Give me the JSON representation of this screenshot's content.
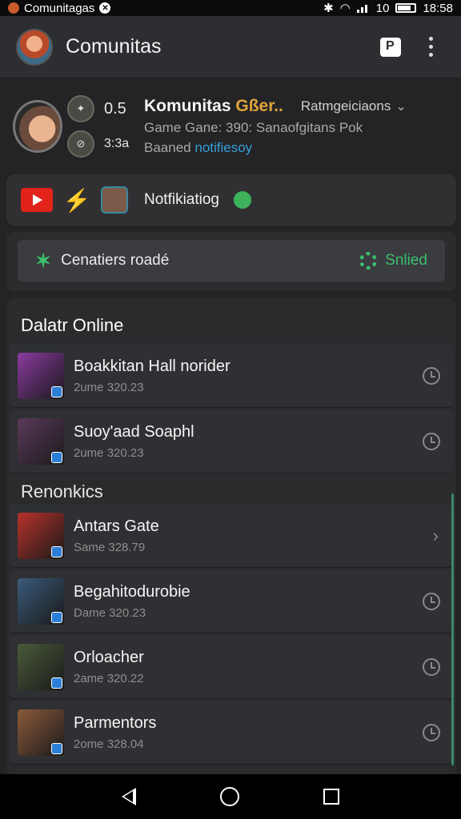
{
  "statusbar": {
    "app_name": "Comunitagas",
    "time": "18:58",
    "battery_label": "10"
  },
  "appbar": {
    "title": "Comunitas"
  },
  "community": {
    "badge_value_1": "0.5",
    "badge_value_2": "3:3a",
    "name": "Komunitas",
    "name_accent": "Gßer..",
    "category": "Ratmgeiciaons",
    "line2": "Game Gane: 390: Sanaofgitans Pok",
    "line3_prefix": "Baaned",
    "line3_link": "notifiesoy"
  },
  "notification": {
    "label": "Notfikiatiog"
  },
  "status": {
    "left_label": "Cenatiers roadé",
    "right_label": "Snlied"
  },
  "online": {
    "title": "Dalatr Online",
    "items": [
      {
        "title": "Boakkitan Hall norider",
        "subtitle": "2ume 320.23",
        "thumb_color": "#8a3aa0",
        "action": "clock-icon"
      },
      {
        "title": "Suoy'aad Soaphl",
        "subtitle": "2ume 320.23",
        "thumb_color": "#5a3a5a",
        "action": "clock-icon"
      }
    ]
  },
  "recent": {
    "title": "Renonkics",
    "items": [
      {
        "title": "Antars Gate",
        "subtitle": "Same 328.79",
        "thumb_color": "#b8322a",
        "action": "chevron-right-icon"
      },
      {
        "title": "Begahitodurobie",
        "subtitle": "Dame 320.23",
        "thumb_color": "#3a5a7a",
        "action": "clock-icon"
      },
      {
        "title": "Orloacher",
        "subtitle": "2ame 320.22",
        "thumb_color": "#4a5a3a",
        "action": "clock-icon"
      },
      {
        "title": "Parmentors",
        "subtitle": "2ome 328.04",
        "thumb_color": "#8a5a3a",
        "action": "clock-icon"
      }
    ]
  },
  "colors": {
    "background": "#242427",
    "appbar": "#2d2e31",
    "accent_green": "#3bbf6a",
    "accent_gold": "#e0a33a",
    "link_blue": "#37a0d8"
  }
}
